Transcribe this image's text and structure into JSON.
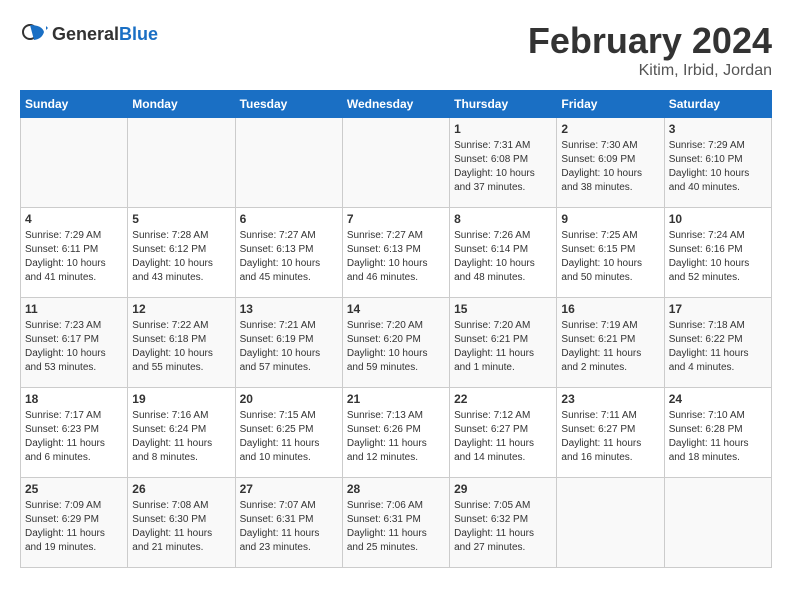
{
  "header": {
    "logo_general": "General",
    "logo_blue": "Blue",
    "main_title": "February 2024",
    "subtitle": "Kitim, Irbid, Jordan"
  },
  "weekdays": [
    "Sunday",
    "Monday",
    "Tuesday",
    "Wednesday",
    "Thursday",
    "Friday",
    "Saturday"
  ],
  "weeks": [
    [
      {
        "day": "",
        "info": ""
      },
      {
        "day": "",
        "info": ""
      },
      {
        "day": "",
        "info": ""
      },
      {
        "day": "",
        "info": ""
      },
      {
        "day": "1",
        "info": "Sunrise: 7:31 AM\nSunset: 6:08 PM\nDaylight: 10 hours\nand 37 minutes."
      },
      {
        "day": "2",
        "info": "Sunrise: 7:30 AM\nSunset: 6:09 PM\nDaylight: 10 hours\nand 38 minutes."
      },
      {
        "day": "3",
        "info": "Sunrise: 7:29 AM\nSunset: 6:10 PM\nDaylight: 10 hours\nand 40 minutes."
      }
    ],
    [
      {
        "day": "4",
        "info": "Sunrise: 7:29 AM\nSunset: 6:11 PM\nDaylight: 10 hours\nand 41 minutes."
      },
      {
        "day": "5",
        "info": "Sunrise: 7:28 AM\nSunset: 6:12 PM\nDaylight: 10 hours\nand 43 minutes."
      },
      {
        "day": "6",
        "info": "Sunrise: 7:27 AM\nSunset: 6:13 PM\nDaylight: 10 hours\nand 45 minutes."
      },
      {
        "day": "7",
        "info": "Sunrise: 7:27 AM\nSunset: 6:13 PM\nDaylight: 10 hours\nand 46 minutes."
      },
      {
        "day": "8",
        "info": "Sunrise: 7:26 AM\nSunset: 6:14 PM\nDaylight: 10 hours\nand 48 minutes."
      },
      {
        "day": "9",
        "info": "Sunrise: 7:25 AM\nSunset: 6:15 PM\nDaylight: 10 hours\nand 50 minutes."
      },
      {
        "day": "10",
        "info": "Sunrise: 7:24 AM\nSunset: 6:16 PM\nDaylight: 10 hours\nand 52 minutes."
      }
    ],
    [
      {
        "day": "11",
        "info": "Sunrise: 7:23 AM\nSunset: 6:17 PM\nDaylight: 10 hours\nand 53 minutes."
      },
      {
        "day": "12",
        "info": "Sunrise: 7:22 AM\nSunset: 6:18 PM\nDaylight: 10 hours\nand 55 minutes."
      },
      {
        "day": "13",
        "info": "Sunrise: 7:21 AM\nSunset: 6:19 PM\nDaylight: 10 hours\nand 57 minutes."
      },
      {
        "day": "14",
        "info": "Sunrise: 7:20 AM\nSunset: 6:20 PM\nDaylight: 10 hours\nand 59 minutes."
      },
      {
        "day": "15",
        "info": "Sunrise: 7:20 AM\nSunset: 6:21 PM\nDaylight: 11 hours\nand 1 minute."
      },
      {
        "day": "16",
        "info": "Sunrise: 7:19 AM\nSunset: 6:21 PM\nDaylight: 11 hours\nand 2 minutes."
      },
      {
        "day": "17",
        "info": "Sunrise: 7:18 AM\nSunset: 6:22 PM\nDaylight: 11 hours\nand 4 minutes."
      }
    ],
    [
      {
        "day": "18",
        "info": "Sunrise: 7:17 AM\nSunset: 6:23 PM\nDaylight: 11 hours\nand 6 minutes."
      },
      {
        "day": "19",
        "info": "Sunrise: 7:16 AM\nSunset: 6:24 PM\nDaylight: 11 hours\nand 8 minutes."
      },
      {
        "day": "20",
        "info": "Sunrise: 7:15 AM\nSunset: 6:25 PM\nDaylight: 11 hours\nand 10 minutes."
      },
      {
        "day": "21",
        "info": "Sunrise: 7:13 AM\nSunset: 6:26 PM\nDaylight: 11 hours\nand 12 minutes."
      },
      {
        "day": "22",
        "info": "Sunrise: 7:12 AM\nSunset: 6:27 PM\nDaylight: 11 hours\nand 14 minutes."
      },
      {
        "day": "23",
        "info": "Sunrise: 7:11 AM\nSunset: 6:27 PM\nDaylight: 11 hours\nand 16 minutes."
      },
      {
        "day": "24",
        "info": "Sunrise: 7:10 AM\nSunset: 6:28 PM\nDaylight: 11 hours\nand 18 minutes."
      }
    ],
    [
      {
        "day": "25",
        "info": "Sunrise: 7:09 AM\nSunset: 6:29 PM\nDaylight: 11 hours\nand 19 minutes."
      },
      {
        "day": "26",
        "info": "Sunrise: 7:08 AM\nSunset: 6:30 PM\nDaylight: 11 hours\nand 21 minutes."
      },
      {
        "day": "27",
        "info": "Sunrise: 7:07 AM\nSunset: 6:31 PM\nDaylight: 11 hours\nand 23 minutes."
      },
      {
        "day": "28",
        "info": "Sunrise: 7:06 AM\nSunset: 6:31 PM\nDaylight: 11 hours\nand 25 minutes."
      },
      {
        "day": "29",
        "info": "Sunrise: 7:05 AM\nSunset: 6:32 PM\nDaylight: 11 hours\nand 27 minutes."
      },
      {
        "day": "",
        "info": ""
      },
      {
        "day": "",
        "info": ""
      }
    ]
  ]
}
